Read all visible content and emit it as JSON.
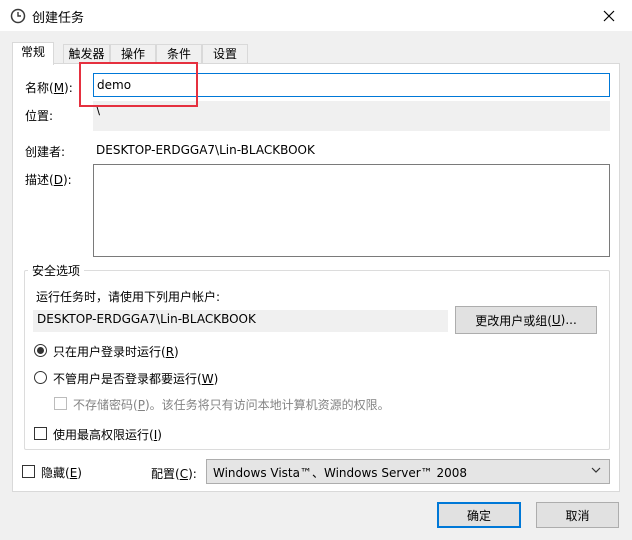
{
  "window": {
    "title": "创建任务"
  },
  "tabs": [
    {
      "label": "常规"
    },
    {
      "label": "触发器"
    },
    {
      "label": "操作"
    },
    {
      "label": "条件"
    },
    {
      "label": "设置"
    }
  ],
  "general": {
    "name_label": "名称(",
    "name_key": "M",
    "name_label_end": "):",
    "name_value": "demo",
    "location_label": "位置:",
    "location_value": "\\",
    "author_label": "创建者:",
    "author_value": "DESKTOP-ERDGGA7\\Lin-BLACKBOOK",
    "description_label": "描述(",
    "description_key": "D",
    "description_label_end": "):"
  },
  "security": {
    "group_title": "安全选项",
    "run_as_text": "运行任务时，请使用下列用户帐户:",
    "user_account": "DESKTOP-ERDGGA7\\Lin-BLACKBOOK",
    "change_user_button": "更改用户或组(",
    "change_user_key": "U",
    "change_user_end": ")...",
    "radio_logged_on": "只在用户登录时运行(",
    "radio_logged_on_key": "R",
    "radio_logged_on_end": ")",
    "radio_any": "不管用户是否登录都要运行(",
    "radio_any_key": "W",
    "radio_any_end": ")",
    "no_store_password": "不存储密码(",
    "no_store_password_key": "P",
    "no_store_password_end": ")。该任务将只有访问本地计算机资源的权限。",
    "highest_privileges": "使用最高权限运行(",
    "highest_privileges_key": "I",
    "highest_privileges_end": ")"
  },
  "footer": {
    "hidden_label": "隐藏(",
    "hidden_key": "E",
    "hidden_end": ")",
    "config_label": "配置(",
    "config_key": "C",
    "config_end": "):",
    "config_value": "Windows Vista™、Windows Server™ 2008",
    "ok_button": "确定",
    "cancel_button": "取消"
  },
  "colors": {
    "accent": "#0078d7",
    "highlight_box": "#e5303f"
  }
}
